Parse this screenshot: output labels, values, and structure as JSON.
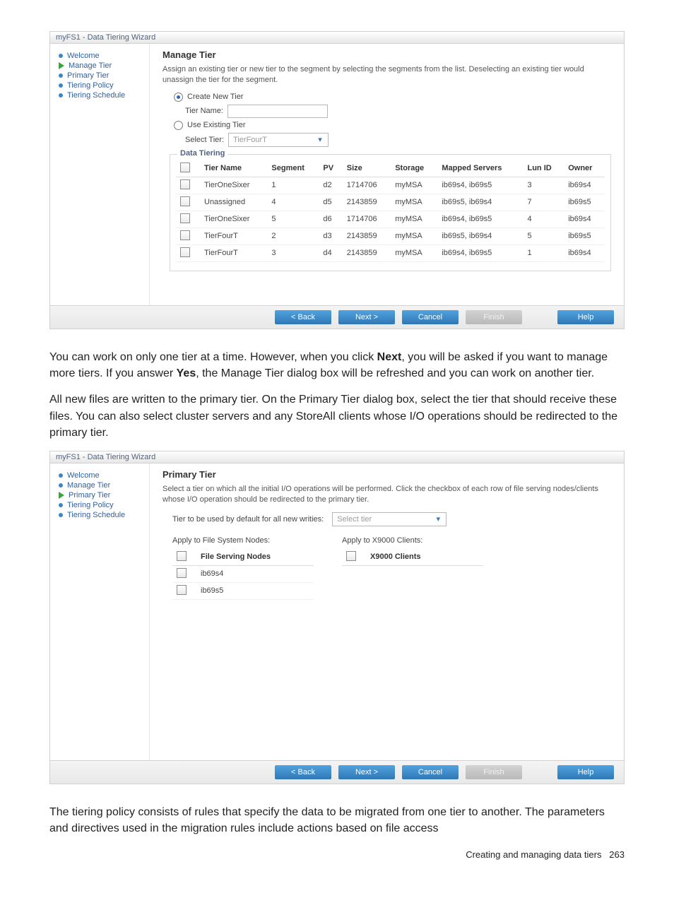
{
  "wizard1": {
    "window_title": "myFS1 - Data Tiering Wizard",
    "nav": {
      "welcome": "Welcome",
      "manage_tier": "Manage Tier",
      "primary_tier": "Primary Tier",
      "tiering_policy": "Tiering Policy",
      "tiering_schedule": "Tiering Schedule"
    },
    "heading": "Manage Tier",
    "description": "Assign an existing tier or new tier to the segment by selecting the segments from the list. Deselecting an existing tier would unassign the tier for the segment.",
    "radio_create_label": "Create New Tier",
    "tier_name_label": "Tier Name:",
    "radio_existing_label": "Use Existing Tier",
    "select_tier_label": "Select Tier:",
    "select_tier_value": "TierFourT",
    "fieldset_label": "Data Tiering",
    "columns": {
      "c0": "",
      "c1": "Tier Name",
      "c2": "Segment",
      "c3": "PV",
      "c4": "Size",
      "c5": "Storage",
      "c6": "Mapped Servers",
      "c7": "Lun ID",
      "c8": "Owner"
    },
    "rows": [
      {
        "tier": "TierOneSixer",
        "segment": "1",
        "pv": "d2",
        "size": "1714706",
        "storage": "myMSA",
        "servers": "ib69s4, ib69s5",
        "lun": "3",
        "owner": "ib69s4"
      },
      {
        "tier": "Unassigned",
        "segment": "4",
        "pv": "d5",
        "size": "2143859",
        "storage": "myMSA",
        "servers": "ib69s5, ib69s4",
        "lun": "7",
        "owner": "ib69s5"
      },
      {
        "tier": "TierOneSixer",
        "segment": "5",
        "pv": "d6",
        "size": "1714706",
        "storage": "myMSA",
        "servers": "ib69s4, ib69s5",
        "lun": "4",
        "owner": "ib69s4"
      },
      {
        "tier": "TierFourT",
        "segment": "2",
        "pv": "d3",
        "size": "2143859",
        "storage": "myMSA",
        "servers": "ib69s5, ib69s4",
        "lun": "5",
        "owner": "ib69s5"
      },
      {
        "tier": "TierFourT",
        "segment": "3",
        "pv": "d4",
        "size": "2143859",
        "storage": "myMSA",
        "servers": "ib69s4, ib69s5",
        "lun": "1",
        "owner": "ib69s4"
      }
    ],
    "buttons": {
      "back": "< Back",
      "next": "Next >",
      "cancel": "Cancel",
      "finish": "Finish",
      "help": "Help"
    }
  },
  "paragraph1": {
    "p1_a": "You can work on only one tier at a time. However, when you click ",
    "p1_b": "Next",
    "p1_c": ", you will be asked if you want to manage more tiers. If you answer ",
    "p1_d": "Yes",
    "p1_e": ", the Manage Tier dialog box will be refreshed and you can work on another tier.",
    "p2": "All new files are written to the primary tier. On the Primary Tier dialog box, select the tier that should receive these files. You can also select cluster servers and any StoreAll clients whose I/O operations should be redirected to the primary tier."
  },
  "wizard2": {
    "window_title": "myFS1 - Data Tiering Wizard",
    "heading": "Primary Tier",
    "description": "Select a tier on which all the initial I/O operations will be performed. Click the checkbox of each row of file serving nodes/clients whose I/O operation should be redirected to the primary tier.",
    "tier_default_label": "Tier to be used by default for all new writies:",
    "tier_default_value": "Select tier",
    "left": {
      "caption": "Apply to File System Nodes:",
      "header": "File Serving Nodes",
      "rows": [
        "ib69s4",
        "ib69s5"
      ]
    },
    "right": {
      "caption": "Apply to X9000 Clients:",
      "header": "X9000 Clients"
    }
  },
  "paragraph2": {
    "p": "The tiering policy consists of rules that specify the data to be migrated from one tier to another. The parameters and directives used in the migration rules include actions based on file access"
  },
  "footer": {
    "text": "Creating and managing data tiers",
    "page": "263"
  }
}
